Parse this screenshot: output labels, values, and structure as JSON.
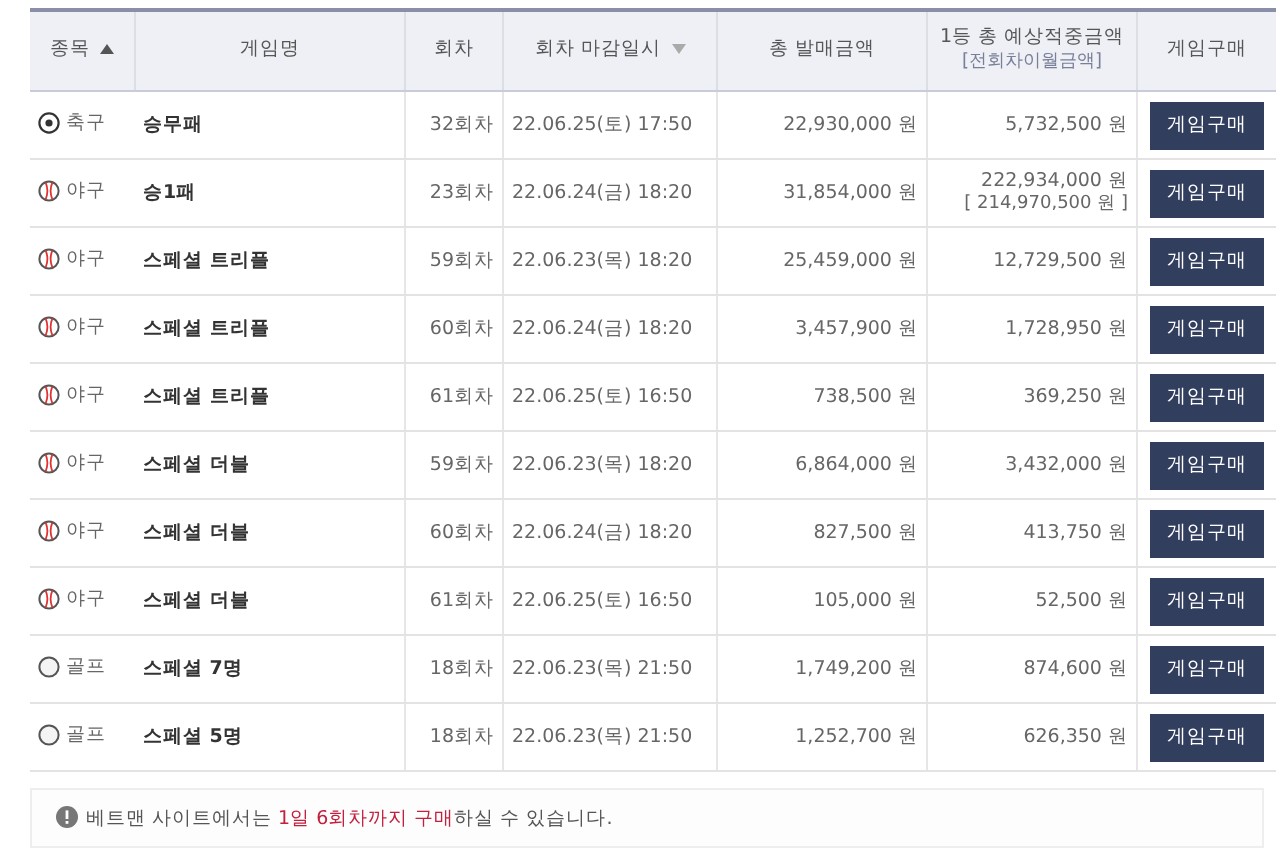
{
  "table": {
    "columns": [
      {
        "label": "종목",
        "kind": "ascending"
      },
      {
        "label": "게임명",
        "kind": "plain"
      },
      {
        "label": "회차",
        "kind": "plain"
      },
      {
        "label": "회차 마감일시",
        "kind": "descending"
      },
      {
        "label": "총 발매금액",
        "kind": "plain"
      },
      {
        "label": "1등 총 예상적중금액",
        "sublabel": "[전회차이월금액]",
        "kind": "plain"
      },
      {
        "label": "게임구매",
        "kind": "plain"
      }
    ],
    "rows": [
      {
        "kind": "soccer",
        "sport": "축구",
        "game": "승무패",
        "round": "32회차",
        "deadline": "22.06.25(토) 17:50",
        "sales": "22,930,000 원",
        "prize": "5,732,500 원",
        "button": "게임구매"
      },
      {
        "kind": "baseball",
        "sport": "야구",
        "game": "승1패",
        "round": "23회차",
        "deadline": "22.06.24(금) 18:20",
        "sales": "31,854,000 원",
        "prize": "222,934,000 원",
        "carryover": "[ 214,970,500 원 ]",
        "button": "게임구매"
      },
      {
        "kind": "baseball",
        "sport": "야구",
        "game": "스페셜 트리플",
        "round": "59회차",
        "deadline": "22.06.23(목) 18:20",
        "sales": "25,459,000 원",
        "prize": "12,729,500 원",
        "button": "게임구매"
      },
      {
        "kind": "baseball",
        "sport": "야구",
        "game": "스페셜 트리플",
        "round": "60회차",
        "deadline": "22.06.24(금) 18:20",
        "sales": "3,457,900 원",
        "prize": "1,728,950 원",
        "button": "게임구매"
      },
      {
        "kind": "baseball",
        "sport": "야구",
        "game": "스페셜 트리플",
        "round": "61회차",
        "deadline": "22.06.25(토) 16:50",
        "sales": "738,500 원",
        "prize": "369,250 원",
        "button": "게임구매"
      },
      {
        "kind": "baseball",
        "sport": "야구",
        "game": "스페셜 더블",
        "round": "59회차",
        "deadline": "22.06.23(목) 18:20",
        "sales": "6,864,000 원",
        "prize": "3,432,000 원",
        "button": "게임구매"
      },
      {
        "kind": "baseball",
        "sport": "야구",
        "game": "스페셜 더블",
        "round": "60회차",
        "deadline": "22.06.24(금) 18:20",
        "sales": "827,500 원",
        "prize": "413,750 원",
        "button": "게임구매"
      },
      {
        "kind": "baseball",
        "sport": "야구",
        "game": "스페셜 더블",
        "round": "61회차",
        "deadline": "22.06.25(토) 16:50",
        "sales": "105,000 원",
        "prize": "52,500 원",
        "button": "게임구매"
      },
      {
        "kind": "golf",
        "sport": "골프",
        "game": "스페셜 7명",
        "round": "18회차",
        "deadline": "22.06.23(목) 21:50",
        "sales": "1,749,200 원",
        "prize": "874,600 원",
        "button": "게임구매"
      },
      {
        "kind": "golf",
        "sport": "골프",
        "game": "스페셜 5명",
        "round": "18회차",
        "deadline": "22.06.23(목) 21:50",
        "sales": "1,252,700 원",
        "prize": "626,350 원",
        "button": "게임구매"
      }
    ]
  },
  "notice": {
    "parts": [
      {
        "text": "베트맨 사이트에서는 ",
        "highlight": false
      },
      {
        "text": "1일 6회차까지 구매",
        "highlight": true
      },
      {
        "text": "하실 수 있습니다.",
        "highlight": false
      }
    ]
  }
}
